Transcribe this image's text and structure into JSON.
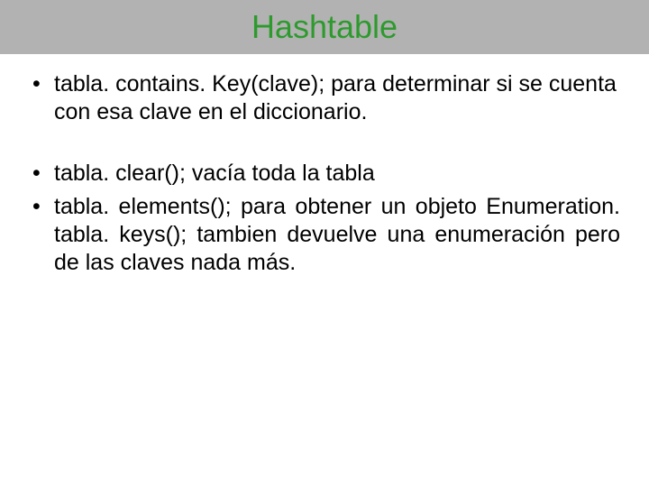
{
  "title": "Hashtable",
  "bullets_group1": [
    "tabla. contains. Key(clave); para determinar si se cuenta con esa clave en el diccionario."
  ],
  "bullets_group2": [
    "tabla. clear(); vacía toda la tabla",
    "tabla. elements(); para obtener un objeto Enumeration. tabla. keys(); tambien devuelve una enumeración pero de las claves nada más."
  ]
}
